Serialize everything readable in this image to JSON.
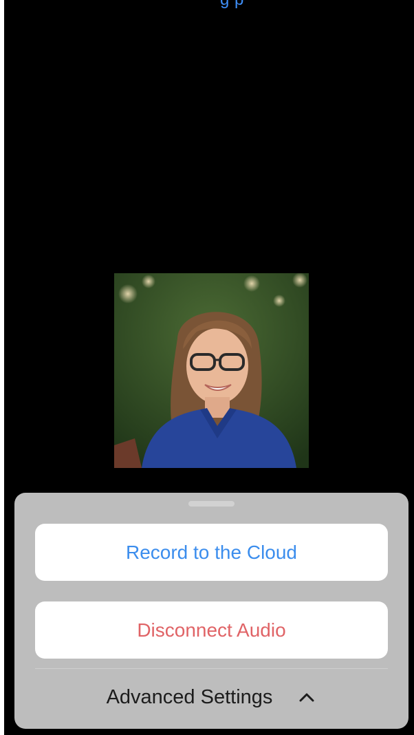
{
  "header": {
    "link_text": "g    p"
  },
  "participant": {
    "avatar_desc": "profile-photo"
  },
  "action_sheet": {
    "buttons": [
      {
        "label": "Record to the Cloud",
        "color": "#3b8ded"
      },
      {
        "label": "Disconnect Audio",
        "color": "#e06366"
      }
    ],
    "advanced_label": "Advanced Settings",
    "advanced_icon": "chevron-up-icon"
  },
  "colors": {
    "background": "#000000",
    "sheet": "#bdbdbd",
    "button_bg": "#ffffff",
    "accent_blue": "#3b8ded",
    "destructive_red": "#e06366"
  }
}
